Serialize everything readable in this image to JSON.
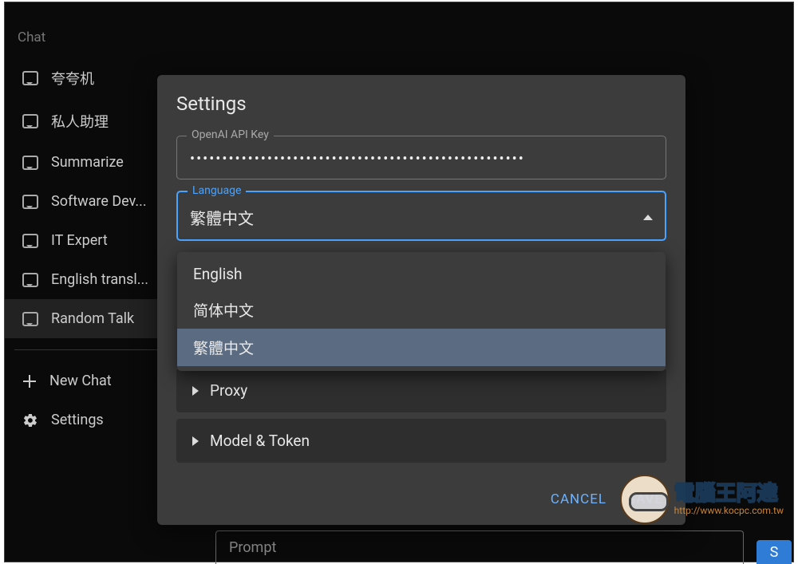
{
  "sidebar": {
    "section_label": "Chat",
    "items": [
      {
        "label": "夸夸机",
        "active": false
      },
      {
        "label": "私人助理",
        "active": false
      },
      {
        "label": "Summarize",
        "active": false
      },
      {
        "label": "Software Dev...",
        "active": false
      },
      {
        "label": "IT Expert",
        "active": false
      },
      {
        "label": "English transl...",
        "active": false
      },
      {
        "label": "Random Talk",
        "active": true
      }
    ],
    "new_chat": "New Chat",
    "settings": "Settings"
  },
  "prompt": {
    "placeholder": "Prompt",
    "send_label": "S"
  },
  "modal": {
    "title": "Settings",
    "api_key": {
      "label": "OpenAI API Key",
      "masked_value": "••••••••••••••••••••••••••••••••••••••••••••••••••••"
    },
    "language": {
      "label": "Language",
      "value": "繁體中文",
      "options": [
        {
          "label": "English",
          "selected": false
        },
        {
          "label": "简体中文",
          "selected": false
        },
        {
          "label": "繁體中文",
          "selected": true
        }
      ]
    },
    "accordions": [
      {
        "label": "Proxy"
      },
      {
        "label": "Model & Token"
      }
    ],
    "cancel": "CANCEL",
    "save": "SAVE"
  },
  "watermark": {
    "title": "電腦王阿達",
    "url": "http://www.kocpc.com.tw"
  }
}
